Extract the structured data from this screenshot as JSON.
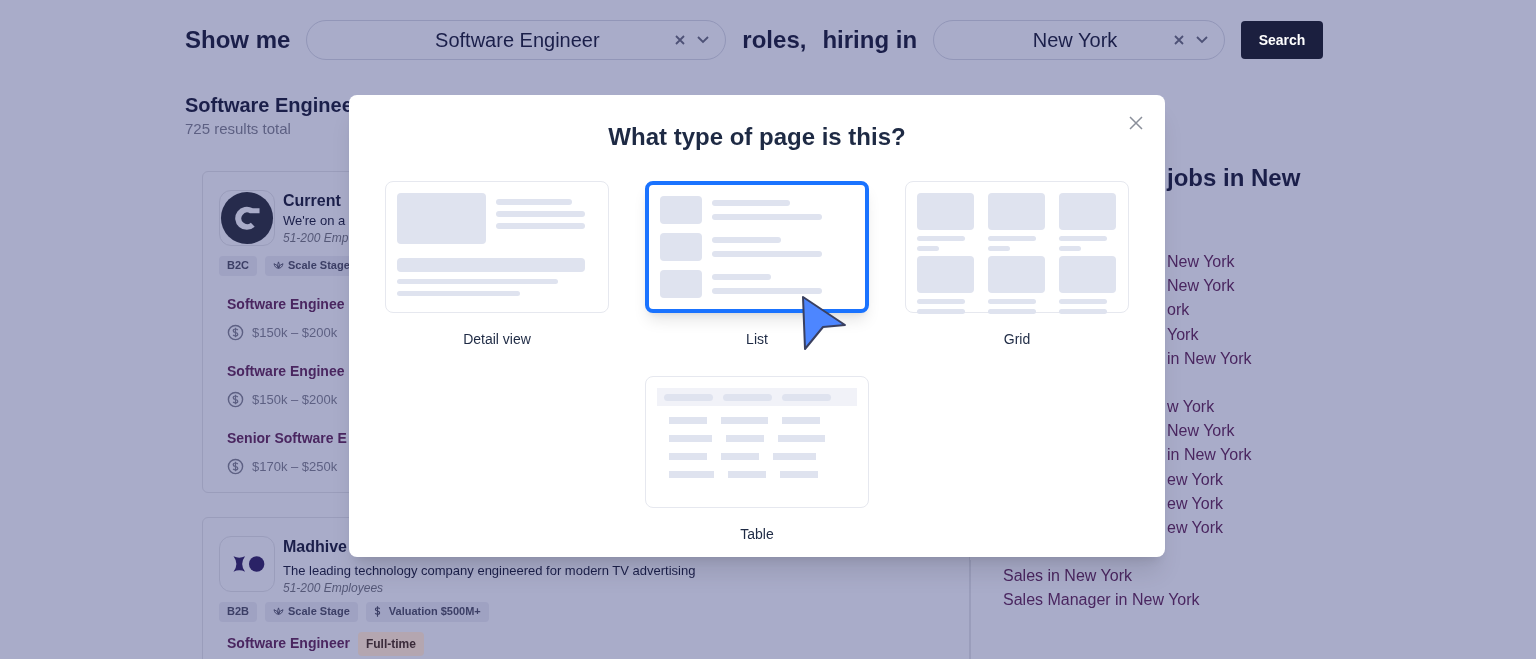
{
  "search_bar": {
    "prefix": "Show me",
    "role_field": {
      "value": "Software Engineer"
    },
    "middle_1": "roles,",
    "middle_2": "hiring in",
    "location_field": {
      "value": "New York"
    },
    "button": "Search"
  },
  "results": {
    "title": "Software Enginee",
    "count": "725 results total",
    "companies": [
      {
        "kind": "c-mark",
        "name": "Current",
        "tagline": "We're on a",
        "size": "51-200 Emp",
        "tags": [
          {
            "kind": "plain",
            "label": "B2C"
          },
          {
            "kind": "stage",
            "label": "Scale Stage"
          }
        ],
        "jobs": [
          {
            "title": "Software Enginee",
            "salary": "$150k – $200k"
          },
          {
            "title": "Software Enginee",
            "salary": "$150k – $200k"
          },
          {
            "title": "Senior Software E",
            "salary": "$170k – $250k"
          }
        ]
      },
      {
        "kind": "x-dot",
        "name": "Madhive",
        "tagline": "The leading technology company engineered for modern TV advertising",
        "size": "51-200 Employees",
        "tags": [
          {
            "kind": "plain",
            "label": "B2B"
          },
          {
            "kind": "stage",
            "label": "Scale Stage"
          },
          {
            "kind": "valuation",
            "label": "Valuation $500M+"
          }
        ],
        "jobs": [
          {
            "title": "Software Engineer",
            "type": "Full-time"
          }
        ]
      }
    ]
  },
  "sidebar": {
    "heading": "jobs in New",
    "groups": [
      [
        "New York",
        "New York",
        "ork",
        "York",
        "in New York"
      ],
      [
        "w York",
        "New York",
        "in New York",
        "ew York",
        "ew York",
        "ew York"
      ],
      [
        "Sales in New York",
        "Sales Manager in New York"
      ]
    ]
  },
  "modal": {
    "title": "What type of page is this?",
    "options": [
      {
        "kind": "detail",
        "label": "Detail view",
        "selected": false
      },
      {
        "kind": "list",
        "label": "List",
        "selected": true
      },
      {
        "kind": "grid",
        "label": "Grid",
        "selected": false
      },
      {
        "kind": "table",
        "label": "Table",
        "selected": false
      }
    ]
  }
}
